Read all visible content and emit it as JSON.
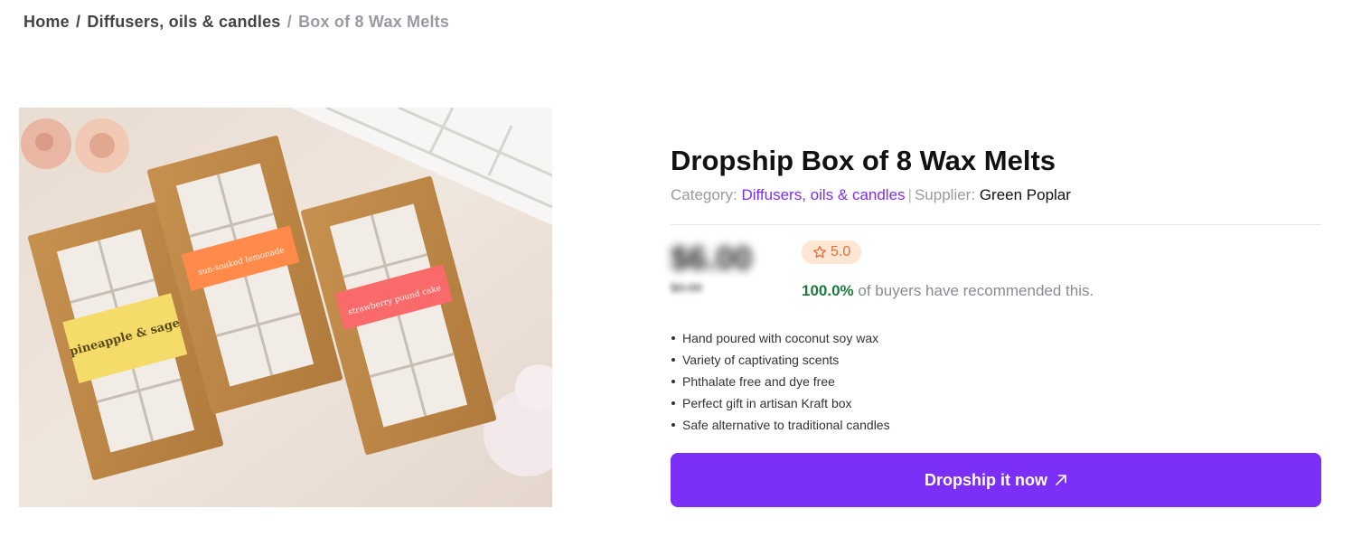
{
  "breadcrumb": {
    "home": "Home",
    "category": "Diffusers, oils & candles",
    "current": "Box of 8 Wax Melts",
    "separator": "/"
  },
  "product": {
    "title": "Dropship Box of 8 Wax Melts",
    "category_label": "Category:",
    "category": "Diffusers, oils & candles",
    "divider": "|",
    "supplier_label": "Supplier:",
    "supplier": "Green Poplar",
    "price": "$6.00",
    "old_price": "$0.00",
    "rating": "5.0",
    "recommend_pct": "100.0%",
    "recommend_text": "of buyers have recommended this.",
    "features": [
      "Hand poured with coconut soy wax",
      "Variety of captivating scents",
      "Phthalate free and dye free",
      "Perfect gift in artisan Kraft box",
      "Safe alternative to traditional candles"
    ],
    "cta_label": "Dropship it now",
    "image_labels": [
      "pineapple & sage",
      "sun-soaked lemonade",
      "strawberry pound cake"
    ]
  },
  "colors": {
    "accent": "#7b2ff7",
    "category_link": "#7b2ff2",
    "recommend_green": "#1e7b3b",
    "rating_bg": "#fde6d3",
    "rating_fg": "#e2703a"
  },
  "icons": {
    "rating": "star-outline-icon",
    "cta": "arrow-up-right-icon"
  }
}
